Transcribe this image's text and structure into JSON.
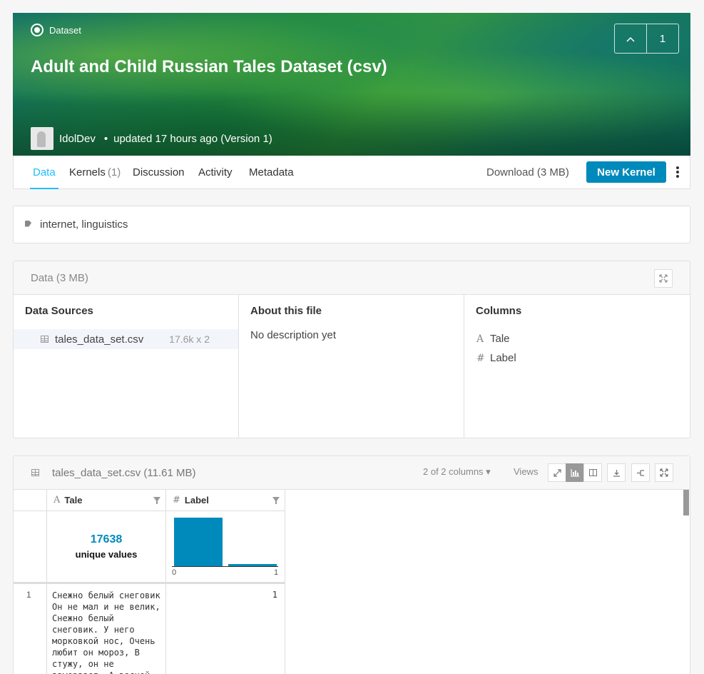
{
  "header": {
    "badge": "Dataset",
    "title": "Adult and Child Russian Tales Dataset (csv)",
    "vote_count": "1",
    "author": "IdolDev",
    "updated": "updated 17 hours ago (Version 1)",
    "dot": "•"
  },
  "tabs": [
    {
      "label": "Data",
      "count": ""
    },
    {
      "label": "Kernels",
      "count": "(1)"
    },
    {
      "label": "Discussion",
      "count": ""
    },
    {
      "label": "Activity",
      "count": ""
    },
    {
      "label": "Metadata",
      "count": ""
    }
  ],
  "actions": {
    "download": "Download (3 MB)",
    "new_kernel": "New Kernel"
  },
  "tags": "internet, linguistics",
  "data_section": {
    "title": "Data (3 MB)",
    "sources_heading": "Data Sources",
    "source_file": "tales_data_set.csv",
    "source_size": "17.6k x 2",
    "about_heading": "About this file",
    "about_text": "No description yet",
    "columns_heading": "Columns",
    "columns": [
      {
        "type": "A",
        "name": "Tale"
      },
      {
        "type": "#",
        "name": "Label"
      }
    ]
  },
  "file_preview": {
    "title": "tales_data_set.csv (11.61 MB)",
    "columns_selector": "2 of 2 columns ▾",
    "views_label": "Views",
    "table": {
      "headers": [
        {
          "type": "A",
          "name": "Tale"
        },
        {
          "type": "#",
          "name": "Label"
        }
      ],
      "tale_unique_count": "17638",
      "tale_unique_label": "unique values",
      "label_hist": {
        "bins": [
          "0",
          "1"
        ],
        "relative_heights": [
          1.0,
          0.04
        ]
      },
      "rows": [
        {
          "index": "1",
          "tale": "Снежно белый снеговик Он не мал и не велик, Снежно белый снеговик. У него морковкой нос, Очень любит он мороз, В стужу, он не замерзает, А весной он тает.",
          "label": "1"
        }
      ]
    }
  },
  "colors": {
    "accent": "#20beff",
    "primary_button": "#008abc",
    "histogram": "#008abc"
  }
}
